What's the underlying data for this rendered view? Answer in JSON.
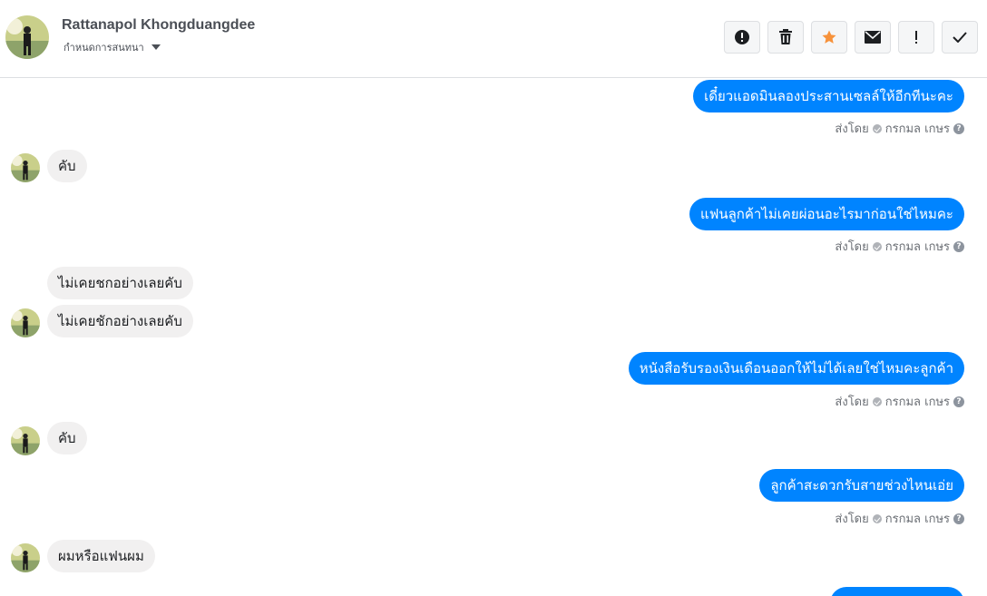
{
  "header": {
    "name": "Rattanapol Khongduangdee",
    "subtitle": "กำหนดการสนทนา"
  },
  "actions": [
    {
      "icon": "alert-circle-icon"
    },
    {
      "icon": "trash-icon"
    },
    {
      "icon": "star-icon",
      "color": "#f7923b"
    },
    {
      "icon": "envelope-icon"
    },
    {
      "icon": "exclamation-icon"
    },
    {
      "icon": "check-icon"
    }
  ],
  "messages": [
    {
      "dir": "out",
      "text": "เดี๋ยวแอดมินลองประสานเซลล์ให้อีกทีนะคะ",
      "sent_prefix": "ส่งโดย",
      "sender": "กรกมล เกษร"
    },
    {
      "dir": "in",
      "text": "คับ"
    },
    {
      "dir": "out",
      "text": "แฟนลูกค้าไม่เคยผ่อนอะไรมาก่อนใช่ไหมคะ",
      "sent_prefix": "ส่งโดย",
      "sender": "กรกมล เกษร"
    },
    {
      "dir": "in",
      "text": "ไม่เคยชกอย่างเลยคับ"
    },
    {
      "dir": "in",
      "text": "ไม่เคยชักอย่างเลยคับ"
    },
    {
      "dir": "out",
      "text": "หนังสือรับรองเงินเดือนออกให้ไม่ได้เลยใช่ไหมคะลูกค้า",
      "sent_prefix": "ส่งโดย",
      "sender": "กรกมล เกษร"
    },
    {
      "dir": "in",
      "text": "คับ"
    },
    {
      "dir": "out",
      "text": "ลูกค้าสะดวกรับสายช่วงไหนเอ่ย",
      "sent_prefix": "ส่งโดย",
      "sender": "กรกมล เกษร"
    },
    {
      "dir": "in",
      "text": "ผมหรือแฟนผม"
    }
  ],
  "colors": {
    "outgoing": "#0084ff",
    "incoming": "#f1f0f0",
    "star": "#f7923b"
  }
}
